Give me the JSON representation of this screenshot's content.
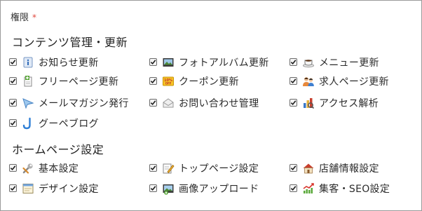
{
  "field": {
    "label": "権限",
    "required_mark": "*"
  },
  "sections": [
    {
      "title": "コンテンツ管理・更新",
      "items": [
        {
          "label": "お知らせ更新",
          "icon": "info-icon",
          "checked": true
        },
        {
          "label": "フォトアルバム更新",
          "icon": "photo-album-icon",
          "checked": true
        },
        {
          "label": "メニュー更新",
          "icon": "coffee-cup-icon",
          "checked": true
        },
        {
          "label": "フリーページ更新",
          "icon": "document-plus-icon",
          "checked": true
        },
        {
          "label": "クーポン更新",
          "icon": "coupon-icon",
          "checked": true
        },
        {
          "label": "求人ページ更新",
          "icon": "people-icon",
          "checked": true
        },
        {
          "label": "メールマガジン発行",
          "icon": "mail-send-icon",
          "checked": true
        },
        {
          "label": "お問い合わせ管理",
          "icon": "envelope-icon",
          "checked": true
        },
        {
          "label": "アクセス解析",
          "icon": "analytics-icon",
          "checked": true
        },
        {
          "label": "グーペブログ",
          "icon": "blog-logo-icon",
          "checked": true
        }
      ]
    },
    {
      "title": "ホームページ設定",
      "items": [
        {
          "label": "基本設定",
          "icon": "wrench-icon",
          "checked": true
        },
        {
          "label": "トップページ設定",
          "icon": "edit-page-icon",
          "checked": true
        },
        {
          "label": "店舗情報設定",
          "icon": "house-icon",
          "checked": true
        },
        {
          "label": "デザイン設定",
          "icon": "design-window-icon",
          "checked": true
        },
        {
          "label": "画像アップロード",
          "icon": "image-upload-icon",
          "checked": true
        },
        {
          "label": "集客・SEO設定",
          "icon": "growth-chart-icon",
          "checked": true
        }
      ]
    }
  ]
}
